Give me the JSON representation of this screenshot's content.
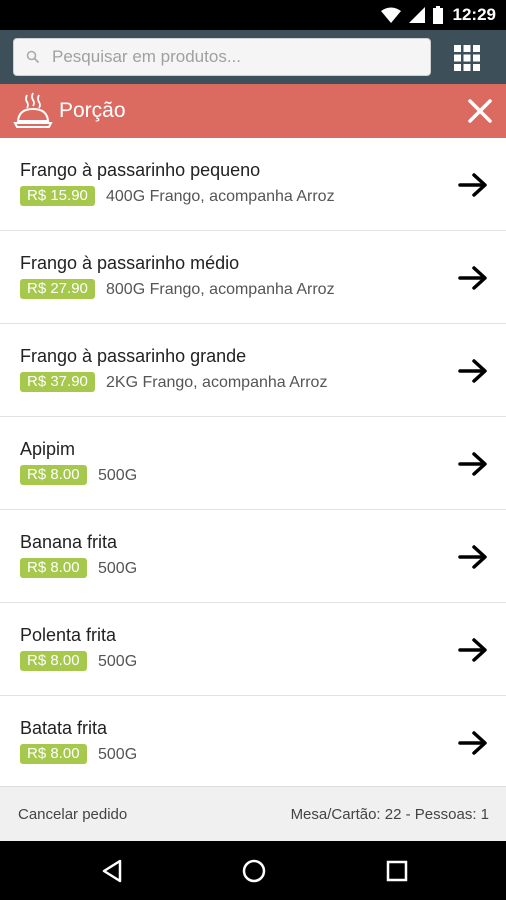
{
  "status_bar": {
    "time": "12:29",
    "icons": [
      "wifi-icon",
      "signal-icon",
      "battery-icon"
    ]
  },
  "search": {
    "placeholder": "Pesquisar em produtos..."
  },
  "category": {
    "title": "Porção",
    "icon": "cloche-icon"
  },
  "products": [
    {
      "name": "Frango à passarinho pequeno",
      "price": "R$ 15.90",
      "description": "400G Frango, acompanha Arroz"
    },
    {
      "name": "Frango à passarinho médio",
      "price": "R$ 27.90",
      "description": "800G Frango, acompanha Arroz"
    },
    {
      "name": "Frango à passarinho grande",
      "price": "R$ 37.90",
      "description": "2KG Frango, acompanha Arroz"
    },
    {
      "name": "Apipim",
      "price": "R$ 8.00",
      "description": "500G"
    },
    {
      "name": "Banana frita",
      "price": "R$ 8.00",
      "description": "500G"
    },
    {
      "name": "Polenta frita",
      "price": "R$ 8.00",
      "description": "500G"
    },
    {
      "name": "Batata frita",
      "price": "R$ 8.00",
      "description": "500G"
    }
  ],
  "footer": {
    "cancel_label": "Cancelar pedido",
    "table_info": "Mesa/Cartão: 22 - Pessoas: 1"
  },
  "colors": {
    "header": "#3d4f58",
    "category": "#db6b60",
    "price_badge": "#a5c84d"
  }
}
